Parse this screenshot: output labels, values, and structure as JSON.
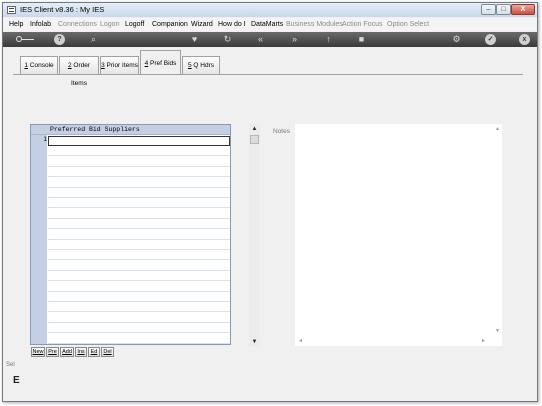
{
  "window": {
    "title": "IES Client v8.36 : My IES",
    "minimize": "–",
    "maximize": "□",
    "close": "X"
  },
  "menu": {
    "items": [
      {
        "label": "Help",
        "enabled": true
      },
      {
        "label": "Infolab",
        "enabled": true
      },
      {
        "label": "Connections",
        "enabled": false
      },
      {
        "label": "Logon",
        "enabled": false
      },
      {
        "label": "Logoff",
        "enabled": true
      },
      {
        "label": "Companion",
        "enabled": true
      },
      {
        "label": "Wizard",
        "enabled": true
      },
      {
        "label": "How do I",
        "enabled": true
      },
      {
        "label": "DataMarts",
        "enabled": true
      },
      {
        "label": "Business Modules",
        "enabled": false
      },
      {
        "label": "Action Focus",
        "enabled": false
      },
      {
        "label": "Option Select",
        "enabled": false
      }
    ]
  },
  "toolbar": {
    "icons": [
      "key-icon",
      "help-icon",
      "search-icon",
      "heart-icon",
      "refresh-icon",
      "rewind-icon",
      "forward-icon",
      "upload-icon",
      "stop-icon",
      "settings-icon",
      "ok-icon",
      "close-icon"
    ],
    "help_glyph": "?",
    "search_glyph": "⌕",
    "heart_glyph": "♥",
    "refresh_glyph": "↻",
    "rewind_glyph": "«",
    "forward_glyph": "»",
    "upload_glyph": "↑",
    "stop_glyph": "■",
    "settings_glyph": "⚙",
    "ok_glyph": "✓",
    "close_glyph": "x"
  },
  "tabs": [
    {
      "key": "1",
      "label": " Console",
      "active": false
    },
    {
      "key": "2",
      "label": " Order Items",
      "active": false
    },
    {
      "key": "3",
      "label": " Prior Items",
      "active": false
    },
    {
      "key": "4",
      "label": " Pref Bids",
      "active": true
    },
    {
      "key": "5",
      "label": " Q Hdrs",
      "active": false
    }
  ],
  "grid": {
    "header": "Preferred Bid Suppliers",
    "current_row_number": "1",
    "rows": [
      "",
      "",
      "",
      "",
      "",
      "",
      "",
      "",
      "",
      "",
      "",
      "",
      "",
      "",
      "",
      "",
      "",
      "",
      "",
      ""
    ]
  },
  "scrollbar": {
    "up": "▲",
    "down": "▼"
  },
  "notes": {
    "label": "Notes",
    "value": "",
    "scroll_up": "▲",
    "scroll_down": "▼",
    "scroll_left": "◄",
    "scroll_right": "►"
  },
  "grid_buttons": [
    {
      "label": "New"
    },
    {
      "label": "Pre"
    },
    {
      "label": "Add"
    },
    {
      "label": "Ins"
    },
    {
      "label": "Ed"
    },
    {
      "label": "Del"
    }
  ],
  "side_stub": {
    "text": "Sel",
    "glyph": "E"
  }
}
